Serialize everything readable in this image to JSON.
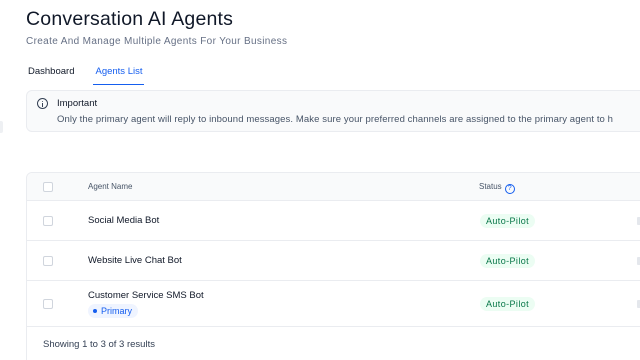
{
  "header": {
    "title": "Conversation AI Agents",
    "subtitle": "Create And Manage Multiple Agents For Your Business"
  },
  "tabs": [
    {
      "label": "Dashboard",
      "active": false
    },
    {
      "label": "Agents List",
      "active": true
    }
  ],
  "alert": {
    "icon": "info-icon",
    "title": "Important",
    "text": "Only the primary agent will reply to inbound messages. Make sure your preferred channels are assigned to the primary agent to h"
  },
  "table": {
    "columns": {
      "name": "Agent Name",
      "status": "Status",
      "status_help_icon": "question-icon",
      "status_help_glyph": "?"
    },
    "rows": [
      {
        "name": "Social Media Bot",
        "status": "Auto-Pilot",
        "badge": ""
      },
      {
        "name": "Website Live Chat Bot",
        "status": "Auto-Pilot",
        "badge": ""
      },
      {
        "name": "Customer Service SMS Bot",
        "status": "Auto-Pilot",
        "badge": "Primary"
      }
    ],
    "footer": "Showing 1 to 3 of 3 results"
  },
  "colors": {
    "accent": "#155eef",
    "status_bg": "#ecfdf3",
    "status_text": "#067647",
    "primary_badge_bg": "#eff4ff"
  }
}
